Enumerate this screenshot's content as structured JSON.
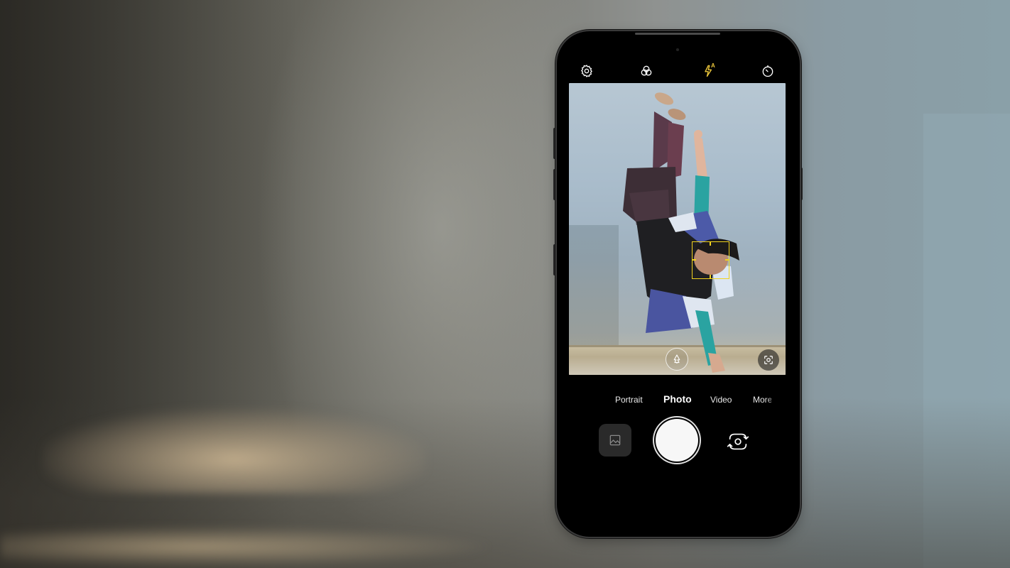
{
  "colors": {
    "accent_yellow": "#f0d21e",
    "phone_body": "#000000",
    "mode_text": "#e8e8e8"
  },
  "top_bar": {
    "icons": [
      "settings-gear-icon",
      "filters-icon",
      "flash-auto-icon",
      "timer-icon"
    ],
    "flash_mode_label": "A"
  },
  "viewfinder": {
    "focus_detection": "face",
    "icons": [
      "scene-detect-icon",
      "lens-switch-icon"
    ]
  },
  "modes": {
    "items": [
      "Portrait",
      "Photo",
      "Video",
      "More"
    ],
    "selected": "Photo",
    "portrait_label": "Portrait",
    "photo_label": "Photo",
    "video_label": "Video",
    "more_label": "More"
  },
  "controls": {
    "gallery_icon": "gallery-icon",
    "shutter": "shutter-button",
    "switch_icon": "switch-camera-icon"
  }
}
